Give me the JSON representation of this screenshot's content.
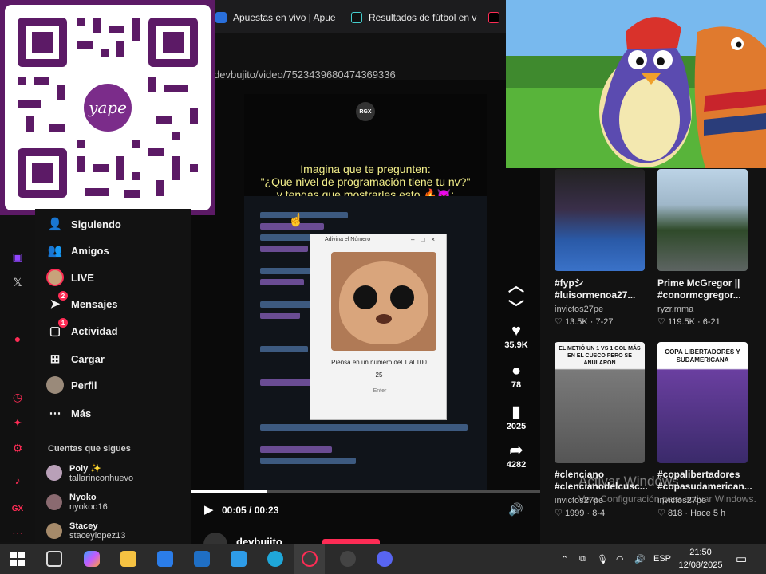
{
  "browser": {
    "tabs": [
      {
        "label": "Apuestas en vivo | Apues"
      },
      {
        "label": "Resultados de fútbol en v"
      }
    ],
    "url": "devbujito/video/7523439680474369336"
  },
  "qr_overlay": {
    "logo_text": "yape"
  },
  "sidebar": {
    "items": [
      {
        "label": "Siguiendo",
        "icon": "following-icon"
      },
      {
        "label": "Amigos",
        "icon": "friends-icon"
      },
      {
        "label": "LIVE",
        "icon": "live-icon"
      },
      {
        "label": "Mensajes",
        "icon": "messages-icon",
        "badge": "2"
      },
      {
        "label": "Actividad",
        "icon": "activity-icon",
        "badge": "1"
      },
      {
        "label": "Cargar",
        "icon": "upload-icon"
      },
      {
        "label": "Perfil",
        "icon": "profile-icon"
      },
      {
        "label": "Más",
        "icon": "more-icon"
      }
    ],
    "following_title": "Cuentas que sigues",
    "following": [
      {
        "name": "Poly ✨",
        "handle": "tallarinconhuevo"
      },
      {
        "name": "Nyoko",
        "handle": "nyokoo16"
      },
      {
        "name": "Stacey",
        "handle": "staceylopez13"
      }
    ]
  },
  "video": {
    "badge": "RGX",
    "caption_line1": "Imagina que te pregunten:",
    "caption_line2": "\"¿Que nivel de programación tiene tu nv?\"",
    "caption_line3": "y tengas que mostrarles esto 🔥😈:",
    "dialog_title": "Adivina el Número",
    "dialog_prompt": "Piensa en un número del 1 al 100",
    "dialog_input": "25",
    "dialog_button": "Enter"
  },
  "actions": {
    "likes": "35.9K",
    "comments": "78",
    "saves": "2025",
    "shares": "4282"
  },
  "player": {
    "time": "00:05 / 00:23",
    "progress": 0.217
  },
  "author": "devbujito",
  "recommended": [
    {
      "title_line1": "#fypシ",
      "title_line2": "#luisormenoa27...",
      "user": "invictos27pe",
      "likes": "13.5K",
      "date": "7-27"
    },
    {
      "title_line1": "Prime McGregor ||",
      "title_line2": "#conormcgregor...",
      "user": "ryzr.mma",
      "likes": "119.5K",
      "date": "6-21"
    },
    {
      "title_line1": "#clenciano",
      "title_line2": "#clencianodelcusc...",
      "user": "invictos27pe",
      "likes": "1999",
      "date": "8-4",
      "thumb_text": "EL METIÓ UN 1 VS 1 GOL MÁS EN EL CUSCO PERO SE ANULARON"
    },
    {
      "title_line1": "#copalibertadores",
      "title_line2": "#copasudamerican...",
      "user": "invictos27pe",
      "likes": "818",
      "date": "Hace 5 h",
      "thumb_text": "COPA LIBERTADORES Y SUDAMERICANA"
    }
  ],
  "watermark": {
    "line1": "Activar Windows",
    "line2": "Ve a Configuración para activar Windows."
  },
  "taskbar": {
    "language": "ESP",
    "time": "21:50",
    "date": "12/08/2025"
  },
  "colors": {
    "accent": "#fe2c55",
    "caption": "#f3ef8a",
    "qr_frame": "#5c1a66"
  }
}
